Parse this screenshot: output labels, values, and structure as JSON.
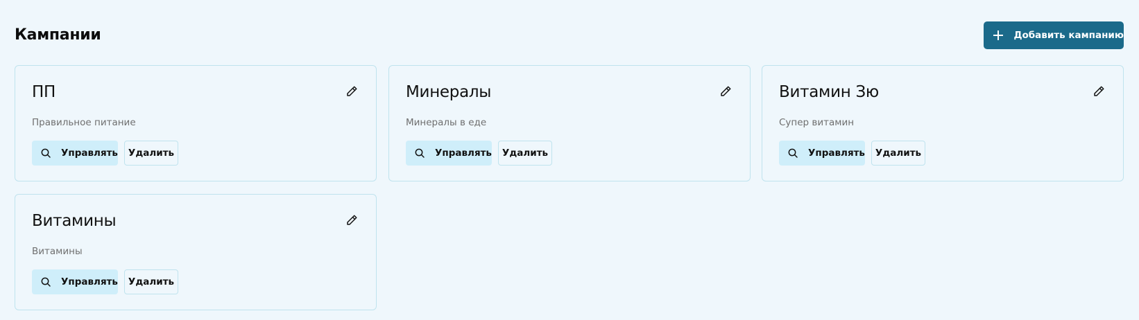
{
  "header": {
    "title": "Кампании",
    "add_button_label": "Добавить кампанию",
    "add_button_color": "#1b6a8a"
  },
  "cards": [
    {
      "title": "ПП",
      "description": "Правильное питание",
      "manage_label": "Управлять",
      "delete_label": "Удалить"
    },
    {
      "title": "Минералы",
      "description": "Минералы в еде",
      "manage_label": "Управлять",
      "delete_label": "Удалить"
    },
    {
      "title": "Витамин Зю",
      "description": "Супер витамин",
      "manage_label": "Управлять",
      "delete_label": "Удалить"
    },
    {
      "title": "Витамины",
      "description": "Витамины",
      "manage_label": "Управлять",
      "delete_label": "Удалить"
    }
  ],
  "icons": {
    "add": "plus-icon",
    "edit": "pencil-icon",
    "manage": "search-icon"
  },
  "colors": {
    "background": "#eff7fc",
    "card_border": "#bfe3ee",
    "manage_button_bg": "#cfeefa"
  }
}
